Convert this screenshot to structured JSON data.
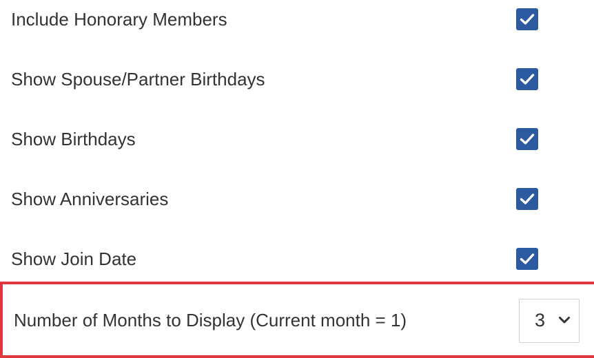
{
  "options": [
    {
      "label": "Include Honorary Members",
      "checked": true
    },
    {
      "label": "Show Spouse/Partner Birthdays",
      "checked": true
    },
    {
      "label": "Show Birthdays",
      "checked": true
    },
    {
      "label": "Show Anniversaries",
      "checked": true
    },
    {
      "label": "Show Join Date",
      "checked": true
    }
  ],
  "months_setting": {
    "label": "Number of Months to Display (Current month = 1)",
    "selected_value": "3"
  },
  "colors": {
    "checkbox": "#2c5aa0",
    "highlight_border": "#e0383e",
    "text": "#333333"
  }
}
